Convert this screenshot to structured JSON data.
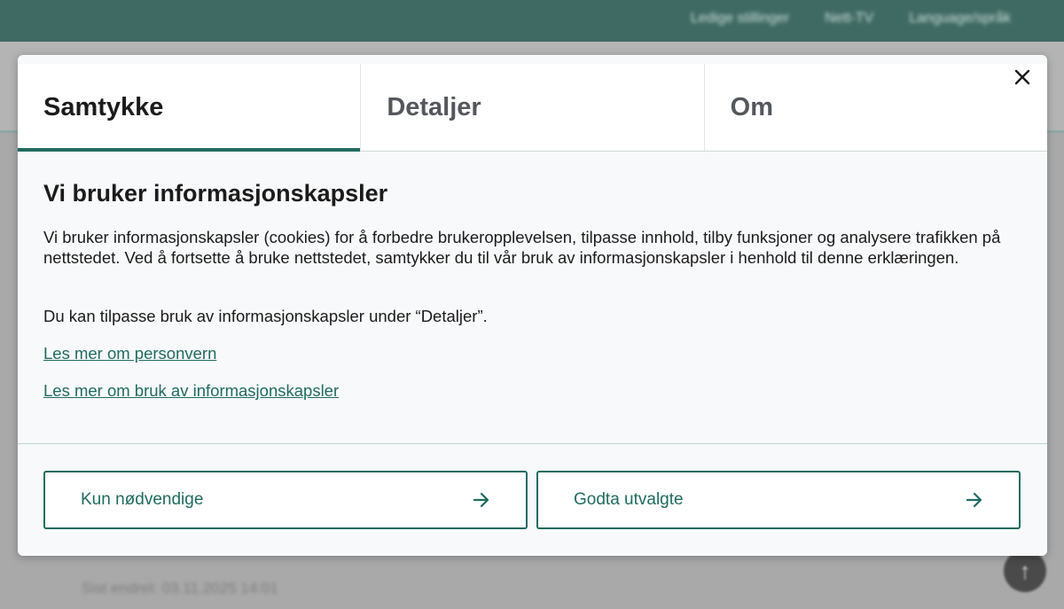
{
  "background": {
    "nav": [
      "Ledige stillinger",
      "Nett-TV",
      "Language/språk"
    ],
    "footer_text": "Sist endret: 03.11.2025 14:01",
    "up_icon": "arrow-up-icon"
  },
  "modal": {
    "tabs": [
      {
        "label": "Samtykke",
        "active": true
      },
      {
        "label": "Detaljer",
        "active": false
      },
      {
        "label": "Om",
        "active": false
      }
    ],
    "close_icon": "close-icon",
    "heading": "Vi bruker informasjonskapsler",
    "paragraph1": "Vi bruker informasjonskapsler (cookies) for å forbedre brukeropplevelsen, tilpasse innhold, tilby funksjoner og analysere trafikken på nettstedet. Ved å fortsette å bruke nettstedet, samtykker du til vår bruk av informasjonskapsler i henhold til denne erklæringen.",
    "paragraph2": "Du kan tilpasse bruk av informasjonskapsler under “Detaljer”.",
    "link1": "Les mer om personvern",
    "link2": "Les mer om bruk av informasjonskapsler",
    "button_necessary": "Kun nødvendige",
    "button_accept": "Godta utvalgte",
    "button_icon": "arrow-right-icon"
  },
  "colors": {
    "accent": "#1f6b60",
    "header_bg": "#3f6a63"
  }
}
